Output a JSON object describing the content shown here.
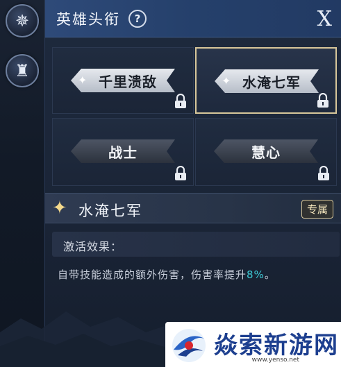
{
  "side": {
    "icon_1": "compass-star-icon",
    "icon_2": "chess-pieces-icon"
  },
  "header": {
    "title": "英雄头衔",
    "help": "?",
    "close": "X"
  },
  "cards": [
    {
      "label": "千里溃敌",
      "style": "light",
      "starred": true,
      "locked": true,
      "selected": false
    },
    {
      "label": "水淹七军",
      "style": "light",
      "starred": true,
      "locked": true,
      "selected": true
    },
    {
      "label": "战士",
      "style": "dark",
      "starred": false,
      "locked": true,
      "selected": false
    },
    {
      "label": "慧心",
      "style": "dark",
      "starred": false,
      "locked": true,
      "selected": false
    }
  ],
  "detail": {
    "name": "水淹七军",
    "tag": "专属",
    "effect_label": "激活效果：",
    "effect_text": "自带技能造成的额外伤害，伤害率提升",
    "effect_value": "8%",
    "effect_end": "。"
  },
  "watermark": {
    "text": "焱索新游网",
    "url": "www.yenso.net"
  },
  "colors": {
    "header_blue": "#2e4a79",
    "selected_border": "#d8c79a",
    "highlight": "#3ecbd6"
  }
}
